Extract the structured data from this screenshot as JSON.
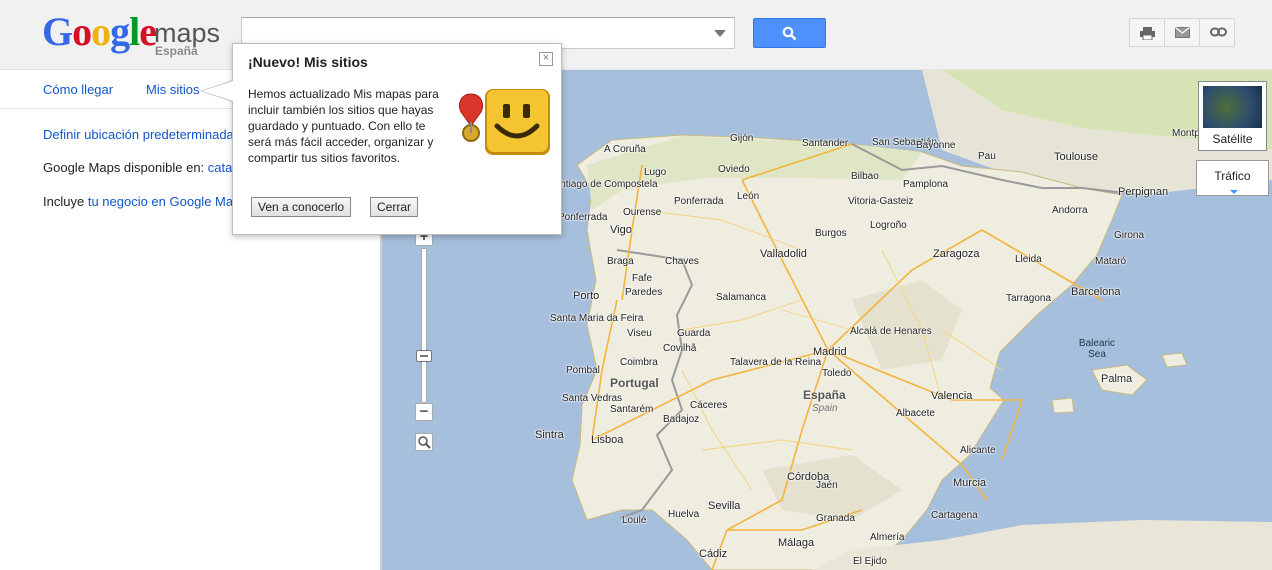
{
  "header": {
    "logo_letters": [
      "G",
      "o",
      "o",
      "g",
      "l",
      "e"
    ],
    "logo_maps": "maps",
    "logo_country": "España",
    "search": {
      "value": "",
      "placeholder": ""
    },
    "tools": [
      "printer-icon",
      "mail-icon",
      "link-icon"
    ]
  },
  "nav": {
    "directions": "Cómo llegar",
    "my_places": "Mis sitios"
  },
  "panel": {
    "set_default_location": "Definir ubicación predeterminada",
    "available_prefix": "Google Maps disponible en:",
    "available_link": "cata",
    "includes_prefix": "Incluye",
    "includes_link": "tu negocio en Google Ma"
  },
  "popup": {
    "title": "¡Nuevo! Mis sitios",
    "close": "×",
    "body": "Hemos actualizado Mis mapas para incluir también los sitios que hayas guardado y puntuado. Con ello te será más fácil acceder, organizar y compartir tus sitios favoritos.",
    "primary_button": "Ven a conocerlo",
    "close_button": "Cerrar"
  },
  "map_controls": {
    "satellite": "Satélite",
    "traffic": "Tráfico",
    "zoom_in": "+",
    "zoom_out": "−"
  },
  "map": {
    "countries": [
      {
        "name": "España",
        "sub": "Spain"
      },
      {
        "name": "Portugal"
      }
    ],
    "seas": [
      "Balearic Sea"
    ],
    "cities": [
      "Gijón",
      "Santander",
      "San Sebastián",
      "Bayonne",
      "Pau",
      "Toulouse",
      "Montpellier",
      "A Coruña",
      "Oviedo",
      "Bilbao",
      "Pamplona",
      "Lugo",
      "Santiago de Compostela",
      "Pontevedra",
      "Ponferrada",
      "León",
      "Vitoria-Gasteiz",
      "Logroño",
      "Ourense",
      "Vigo",
      "Burgos",
      "Andorra",
      "Perpignan",
      "Girona",
      "Braga",
      "Chaves",
      "Valladolid",
      "Zaragoza",
      "Lleida",
      "Mataró",
      "Porto",
      "Fafe",
      "Paredes",
      "Salamanca",
      "Tarragona",
      "Barcelona",
      "Santa Maria da Feira",
      "Viseu",
      "Guarda",
      "Alcalá de Henares",
      "Covilhã",
      "Madrid",
      "Coimbra",
      "Talavera de la Reina",
      "Toledo",
      "Pombal",
      "Palma",
      "Valencia",
      "Santa Vedras",
      "Santarém",
      "Cáceres",
      "Albacete",
      "Sintra",
      "Lisboa",
      "Badajoz",
      "Alicante",
      "Córdoba",
      "Jaén",
      "Murcia",
      "Cartagena",
      "Sevilla",
      "Huelva",
      "Granada",
      "Loulé",
      "Almería",
      "Málaga",
      "Cádiz",
      "El Ejido",
      "Santarém"
    ]
  }
}
